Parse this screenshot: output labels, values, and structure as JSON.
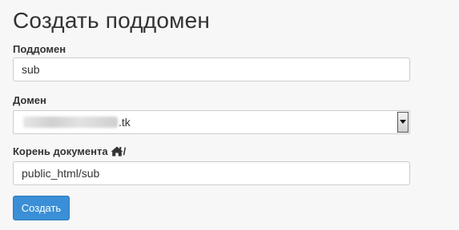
{
  "title": "Создать поддомен",
  "subdomain": {
    "label": "Поддомен",
    "value": "sub"
  },
  "domain": {
    "label": "Домен",
    "value_suffix": ".tk",
    "redacted": true
  },
  "docroot": {
    "label": "Корень документа",
    "label_suffix": "/",
    "icon": "home-icon",
    "value": "public_html/sub"
  },
  "submit": {
    "label": "Создать",
    "color": "#3a8fd6"
  }
}
